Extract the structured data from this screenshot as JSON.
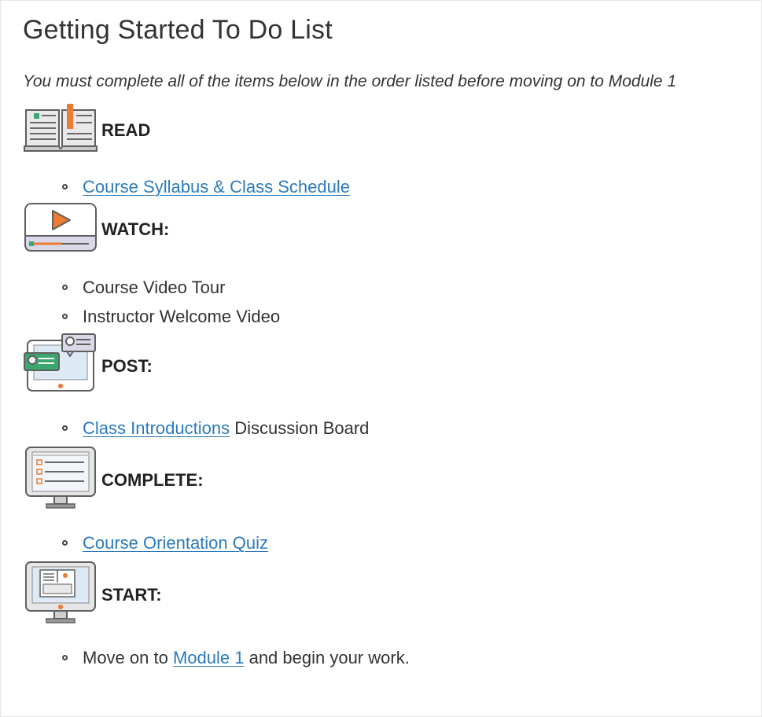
{
  "page": {
    "title": "Getting Started To Do List",
    "intro": "You must complete all of the items below in the order listed before moving on to Module 1"
  },
  "colors": {
    "link": "#2b7abc",
    "accent_orange": "#ee7a33",
    "accent_green": "#3aa86e",
    "icon_outline": "#5f5f5f"
  },
  "sections": {
    "read": {
      "icon": "open-book-icon",
      "label": "READ",
      "item1_link": "Course Syllabus & Class Schedule"
    },
    "watch": {
      "icon": "video-player-icon",
      "label": "WATCH:",
      "item1": "Course Video Tour",
      "item2": "Instructor Welcome Video"
    },
    "post": {
      "icon": "discussion-icon",
      "label": "POST:",
      "item1_link": "Class Introductions",
      "item1_suffix": " Discussion Board"
    },
    "complete": {
      "icon": "checklist-monitor-icon",
      "label": "COMPLETE:",
      "item1_link": "Course Orientation Quiz"
    },
    "start": {
      "icon": "start-monitor-icon",
      "label": "START:",
      "item1_prefix": "Move on to ",
      "item1_link": "Module 1",
      "item1_suffix": " and begin your work."
    }
  }
}
